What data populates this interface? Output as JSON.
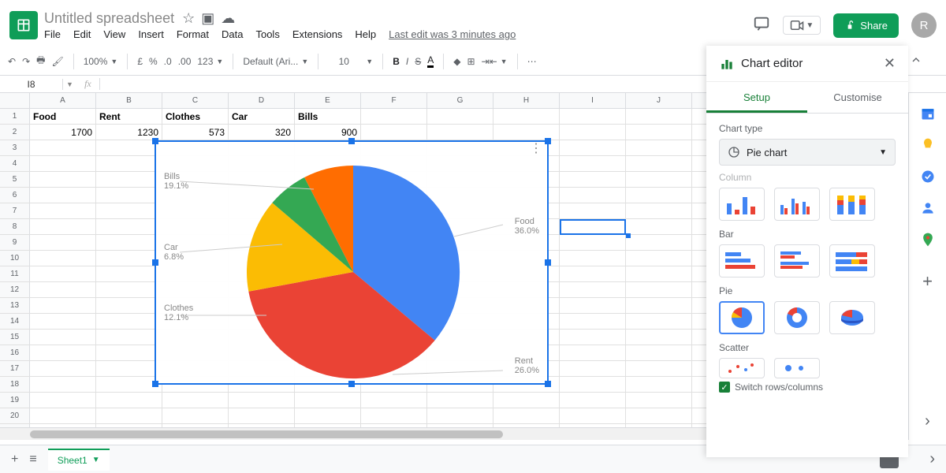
{
  "header": {
    "title": "Untitled spreadsheet",
    "menus": [
      "File",
      "Edit",
      "View",
      "Insert",
      "Format",
      "Data",
      "Tools",
      "Extensions",
      "Help"
    ],
    "last_edit": "Last edit was 3 minutes ago",
    "share": "Share",
    "avatar": "R"
  },
  "toolbar": {
    "zoom": "100%",
    "currency": "£",
    "percent": "%",
    "dec0": ".0",
    "dec00": ".00",
    "fmt": "123",
    "font": "Default (Ari...",
    "size": "10"
  },
  "fxbar": {
    "cell": "I8",
    "fx": "fx"
  },
  "columns": [
    "A",
    "B",
    "C",
    "D",
    "E",
    "F",
    "G",
    "H",
    "I",
    "J"
  ],
  "row1": {
    "A": "Food",
    "B": "Rent",
    "C": "Clothes",
    "D": "Car",
    "E": "Bills"
  },
  "row2": {
    "A": "1700",
    "B": "1230",
    "C": "573",
    "D": "320",
    "E": "900"
  },
  "chart_editor": {
    "title": "Chart editor",
    "tab_setup": "Setup",
    "tab_custom": "Customise",
    "label_type": "Chart type",
    "selected": "Pie chart",
    "sec_column": "Column",
    "sec_bar": "Bar",
    "sec_pie": "Pie",
    "sec_scatter": "Scatter",
    "switch": "Switch rows/columns"
  },
  "sheet_tab": "Sheet1",
  "chart_data": {
    "type": "pie",
    "title": "",
    "categories": [
      "Food",
      "Rent",
      "Clothes",
      "Car",
      "Bills"
    ],
    "values": [
      1700,
      1230,
      573,
      320,
      900
    ],
    "percent_labels": {
      "Food": "36.0%",
      "Rent": "26.0%",
      "Clothes": "12.1%",
      "Car": "6.8%",
      "Bills": "19.1%"
    },
    "colors": {
      "Food": "#4285f4",
      "Rent": "#ea4335",
      "Clothes": "#fbbc04",
      "Car": "#34a853",
      "Bills": "#ff6d01"
    }
  },
  "labels": {
    "food": "Food",
    "rent": "Rent",
    "clothes": "Clothes",
    "car": "Car",
    "bills": "Bills"
  }
}
